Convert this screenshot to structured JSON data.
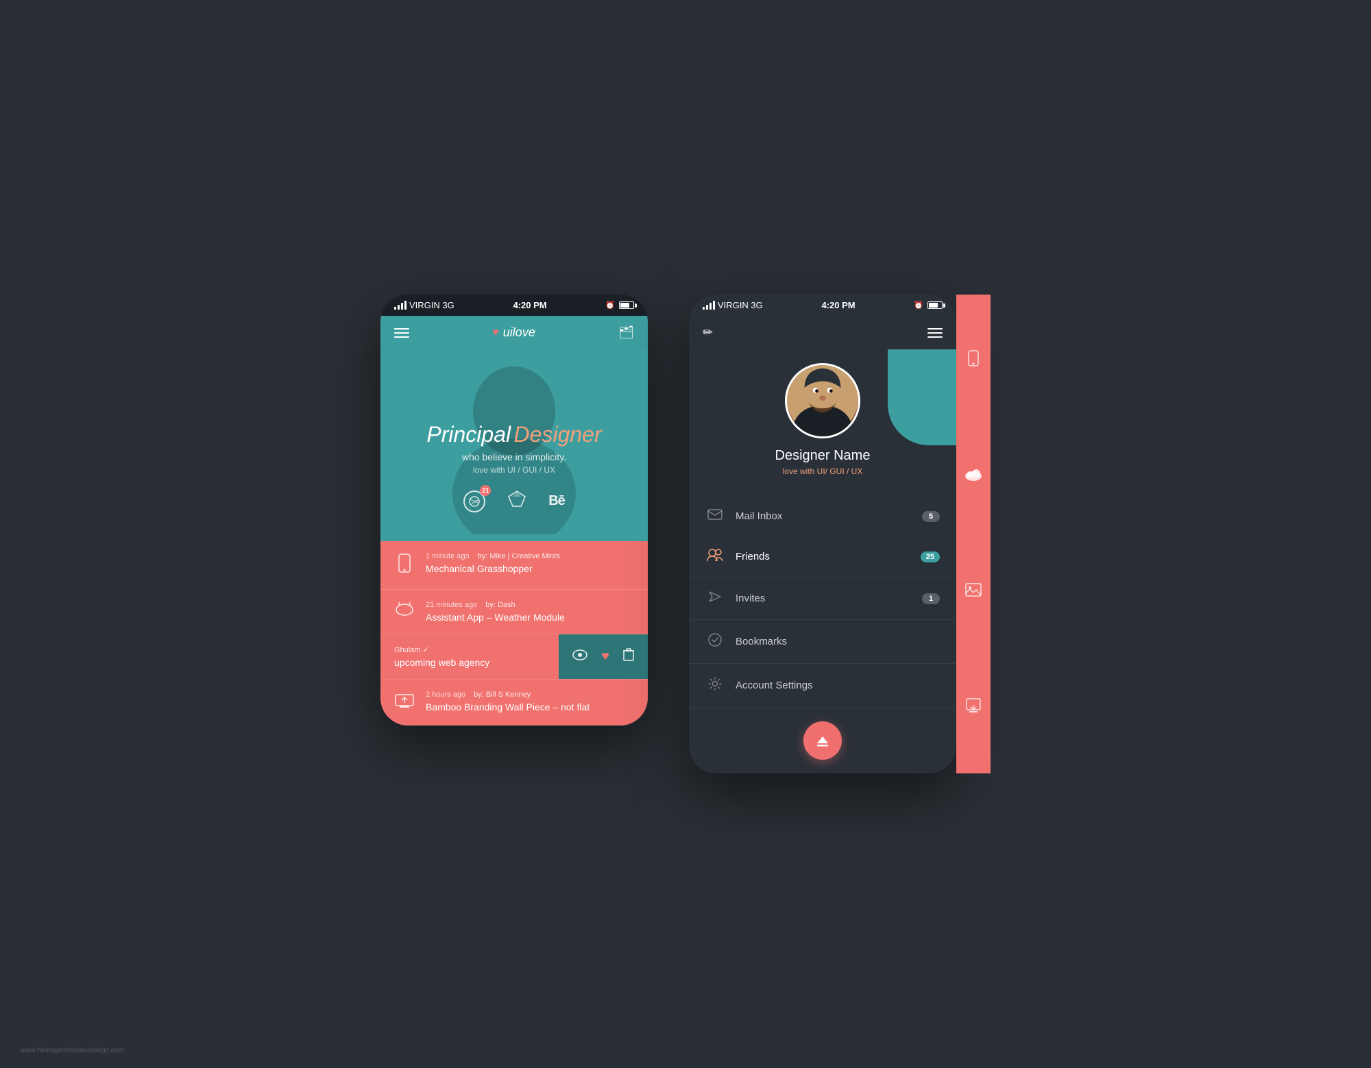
{
  "page": {
    "background": "#2a2f35",
    "watermark": "www.heritagechristiancollege.com"
  },
  "phone1": {
    "status_bar": {
      "carrier": "VIRGIN  3G",
      "time": "4:20 PM"
    },
    "header": {
      "logo_name": "uilove",
      "logo_icon": "♥"
    },
    "hero": {
      "title_main": "Principal",
      "title_accent": "Designer",
      "subtitle": "who believe in simplicity.",
      "tagline": "love with UI / GUI / UX"
    },
    "social": {
      "dribbble_badge": "21"
    },
    "feed_items": [
      {
        "icon": "📱",
        "time": "1 minute ago",
        "author": "by: Mike | Creative Mints",
        "title": "Mechanical Grasshopper"
      },
      {
        "icon": "☁",
        "time": "21 minutes ago",
        "author": "by: Dash",
        "title": "Assistant App – Weather Module"
      },
      {
        "icon": null,
        "time": "",
        "author": "Ghulam ✓",
        "title": "upcoming web agency",
        "has_actions": true
      },
      {
        "icon": "🖥",
        "time": "2 hours ago",
        "author": "by: Bill S Kenney",
        "title": "Bamboo Branding  Wall Piece – not flat"
      }
    ]
  },
  "phone2": {
    "status_bar": {
      "carrier": "VIRGIN  3G",
      "time": "4:20 PM"
    },
    "profile": {
      "name": "Designer Name",
      "tagline": "love with UI/ GUI / UX"
    },
    "menu_items": [
      {
        "label": "Mail Inbox",
        "icon": "mail",
        "badge": "5",
        "badge_type": "default"
      },
      {
        "label": "Friends",
        "icon": "friends",
        "badge": "25",
        "badge_type": "teal"
      },
      {
        "label": "Invites",
        "icon": "invites",
        "badge": "1",
        "badge_type": "default"
      },
      {
        "label": "Bookmarks",
        "icon": "bookmarks",
        "badge": null
      },
      {
        "label": "Account Settings",
        "icon": "settings",
        "badge": null
      }
    ],
    "fab_icon": "⏏"
  }
}
